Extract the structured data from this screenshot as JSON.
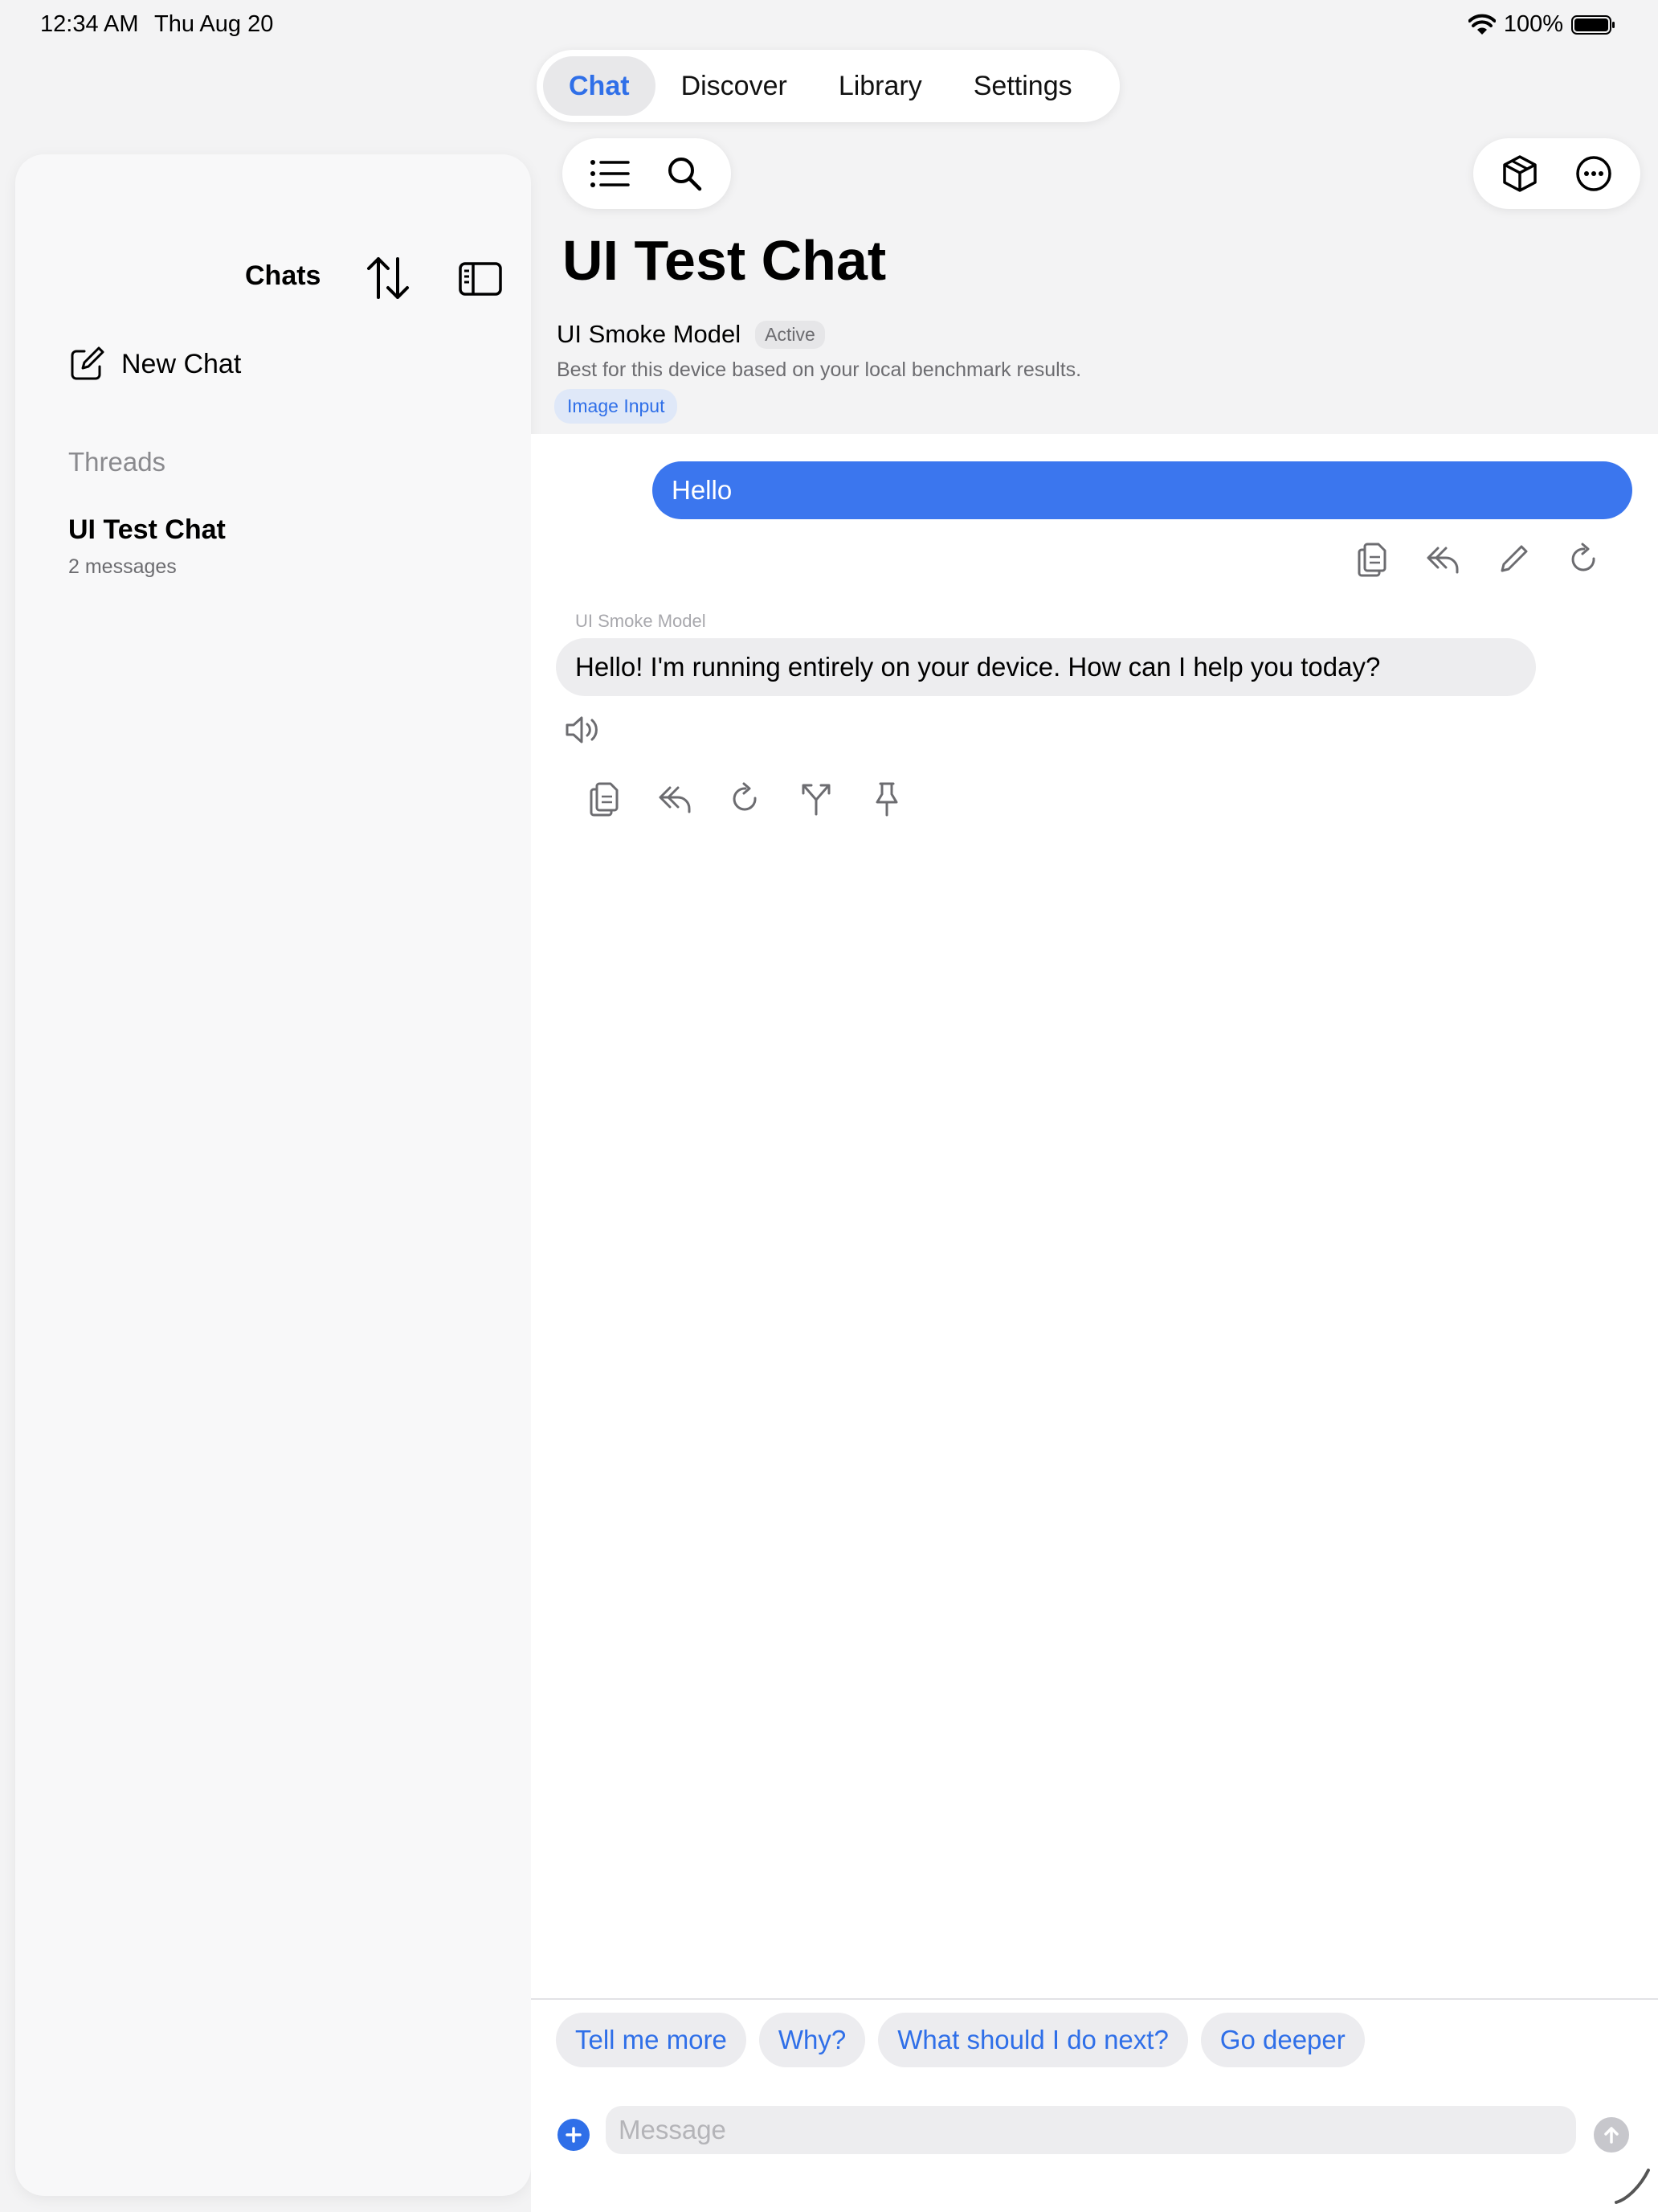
{
  "status_bar": {
    "time": "12:34 AM",
    "date": "Thu Aug 20",
    "battery": "100%",
    "icons": [
      "wifi-icon",
      "battery-icon"
    ]
  },
  "top_tabs": [
    {
      "label": "Chat",
      "active": true
    },
    {
      "label": "Discover",
      "active": false
    },
    {
      "label": "Library",
      "active": false
    },
    {
      "label": "Settings",
      "active": false
    }
  ],
  "sidebar": {
    "title": "Chats",
    "new_chat_label": "New Chat",
    "threads_header": "Threads",
    "threads": [
      {
        "title": "UI Test Chat",
        "subtitle": "2 messages"
      }
    ]
  },
  "header": {
    "title": "UI Test Chat",
    "model_name": "UI Smoke Model",
    "model_status": "Active",
    "model_description": "Best for this device based on your local benchmark results.",
    "capability_tag": "Image Input"
  },
  "messages": [
    {
      "role": "user",
      "text": "Hello",
      "actions": [
        "copy-icon",
        "reply-icon",
        "edit-icon",
        "retry-icon"
      ]
    },
    {
      "role": "assistant",
      "sender": "UI Smoke Model",
      "text": "Hello! I'm running entirely on your device. How can I help you today?",
      "actions": [
        "copy-icon",
        "reply-icon",
        "retry-icon",
        "branch-icon",
        "pin-icon"
      ]
    }
  ],
  "suggestions": [
    "Tell me more",
    "Why?",
    "What should I do next?",
    "Go deeper"
  ],
  "composer": {
    "placeholder": "Message",
    "value": ""
  },
  "colors": {
    "accent": "#2f6fe8",
    "user_bubble": "#3b76ee",
    "assistant_bubble": "#ededef",
    "background": "#f3f3f4"
  }
}
